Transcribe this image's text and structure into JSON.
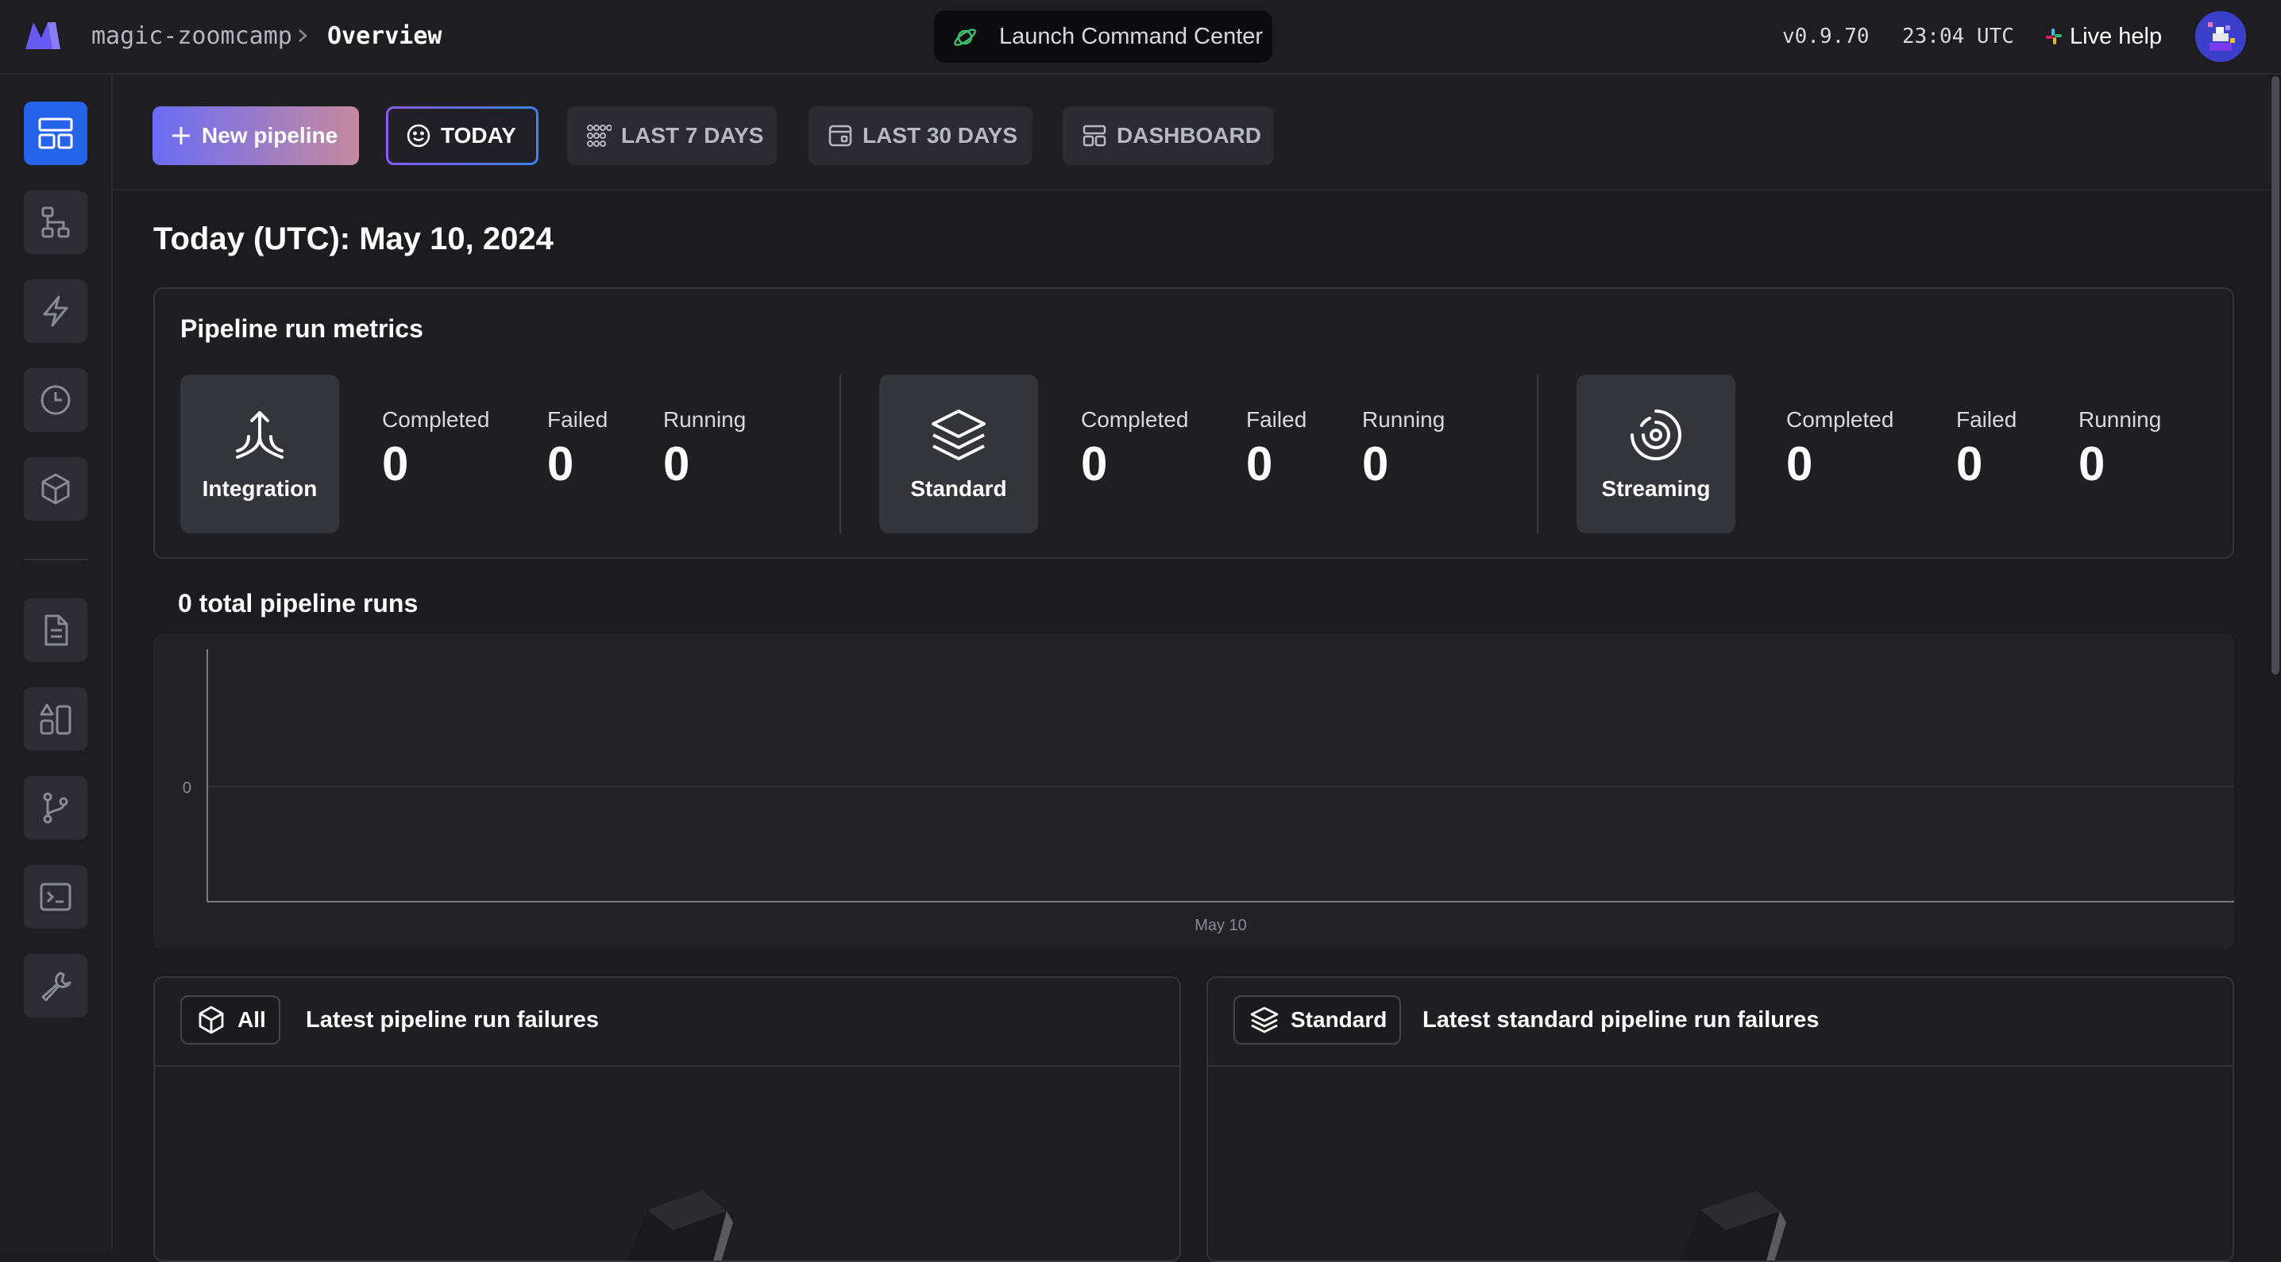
{
  "header": {
    "project": "magic-zoomcamp",
    "page_title": "Overview",
    "launch_label": "Launch Command Center",
    "version": "v0.9.70",
    "clock": "23:04 UTC",
    "live_help": "Live help"
  },
  "sidebar": {
    "items": [
      {
        "name": "overview",
        "icon": "dashboard-icon",
        "active": true
      },
      {
        "name": "pipelines",
        "icon": "pipeline-icon",
        "active": false
      },
      {
        "name": "triggers",
        "icon": "lightning-icon",
        "active": false
      },
      {
        "name": "pipeline-runs",
        "icon": "clock-icon",
        "active": false
      },
      {
        "name": "block-templates",
        "icon": "cube-icon",
        "active": false
      },
      {
        "name": "files",
        "icon": "file-icon",
        "active": false
      },
      {
        "name": "templates",
        "icon": "shapes-icon",
        "active": false
      },
      {
        "name": "version-control",
        "icon": "git-branch-icon",
        "active": false
      },
      {
        "name": "terminal",
        "icon": "terminal-icon",
        "active": false
      },
      {
        "name": "settings",
        "icon": "wrench-icon",
        "active": false
      }
    ]
  },
  "toolbar": {
    "new_pipeline": "New pipeline",
    "today": "TODAY",
    "last_7_days": "LAST 7 DAYS",
    "last_30_days": "LAST 30 DAYS",
    "dashboard": "DASHBOARD"
  },
  "main": {
    "date_heading": "Today (UTC): May 10, 2024",
    "metrics": {
      "title": "Pipeline run metrics",
      "groups": [
        {
          "type": "Integration",
          "icon": "integration-icon",
          "completed": "0",
          "failed": "0",
          "running": "0"
        },
        {
          "type": "Standard",
          "icon": "layers-icon",
          "completed": "0",
          "failed": "0",
          "running": "0"
        },
        {
          "type": "Streaming",
          "icon": "streaming-icon",
          "completed": "0",
          "failed": "0",
          "running": "0"
        }
      ],
      "labels": {
        "completed": "Completed",
        "failed": "Failed",
        "running": "Running"
      }
    },
    "total_runs": "0 total pipeline runs",
    "failures": {
      "all": {
        "chip": "All",
        "title": "Latest pipeline run failures"
      },
      "standard": {
        "chip": "Standard",
        "title": "Latest standard pipeline run failures"
      }
    }
  },
  "chart_data": {
    "type": "bar",
    "categories": [
      "May 10"
    ],
    "values": [
      0
    ],
    "title": "",
    "xlabel": "",
    "ylabel": "",
    "y_ticks": [
      "0"
    ],
    "ylim": [
      0,
      0
    ],
    "grid": true,
    "legend": "none"
  },
  "colors": {
    "background": "#1c1c20",
    "accent_blue": "#2563eb",
    "gradient_start": "#6b6cf5",
    "gradient_end": "#c68a9e",
    "launch_icon": "#3fbf6b"
  }
}
